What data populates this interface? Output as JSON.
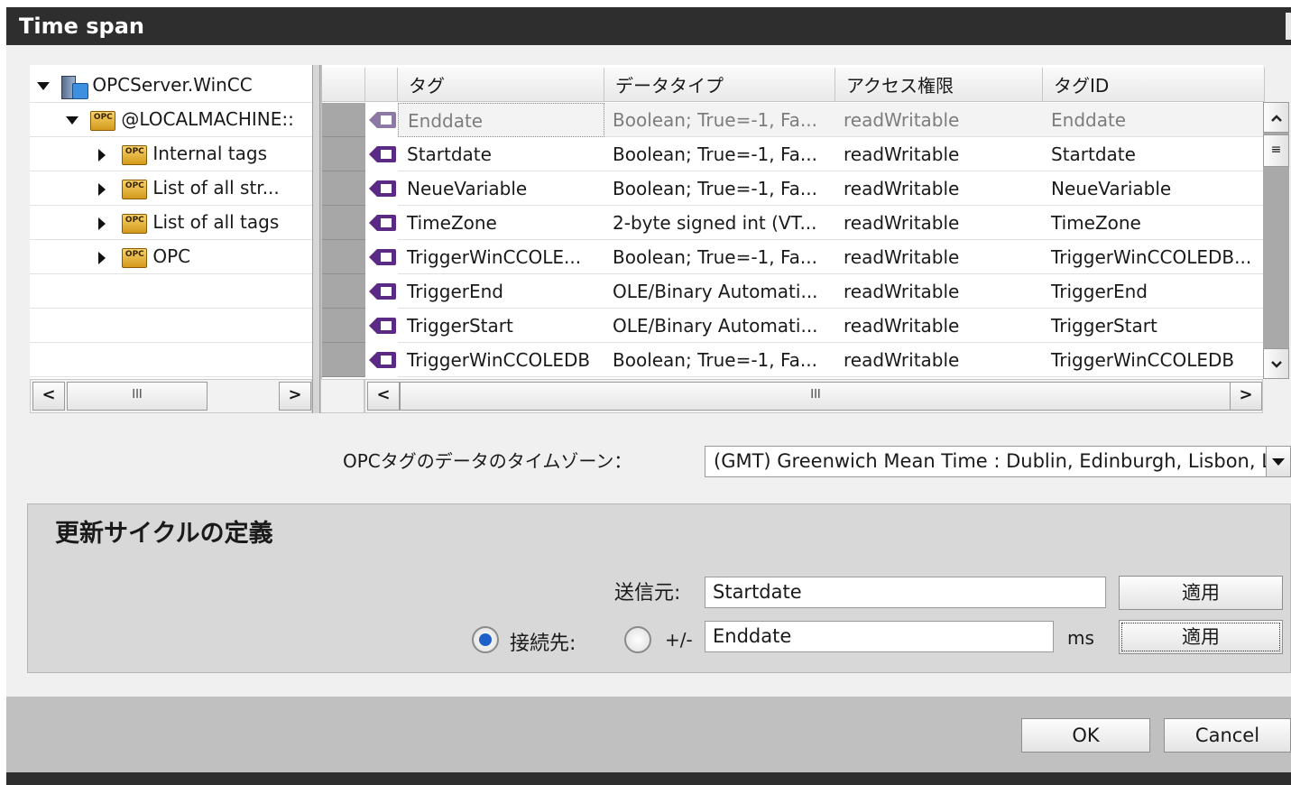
{
  "window": {
    "title": "Time span"
  },
  "tree": {
    "items": [
      {
        "label": "OPCServer.WinCC",
        "icon": "server-icon",
        "expanded": true
      },
      {
        "label": "@LOCALMACHINE::",
        "icon": "opc-folder-icon",
        "expanded": true
      },
      {
        "label": "Internal tags",
        "icon": "opc-folder-icon",
        "expanded": false
      },
      {
        "label": "List of all str...",
        "icon": "opc-folder-icon",
        "expanded": false
      },
      {
        "label": "List of all tags",
        "icon": "opc-folder-icon",
        "expanded": false
      },
      {
        "label": "OPC",
        "icon": "opc-folder-icon",
        "expanded": false
      }
    ],
    "opc_icon_text": "OPC"
  },
  "table": {
    "columns": [
      "タグ",
      "データタイプ",
      "アクセス権限",
      "タグID"
    ],
    "rows": [
      {
        "tag": "Enddate",
        "type": "Boolean; True=-1, Fa...",
        "access": "readWritable",
        "id": "Enddate",
        "selected": true
      },
      {
        "tag": "Startdate",
        "type": "Boolean; True=-1, Fa...",
        "access": "readWritable",
        "id": "Startdate"
      },
      {
        "tag": "NeueVariable",
        "type": "Boolean; True=-1, Fa...",
        "access": "readWritable",
        "id": "NeueVariable"
      },
      {
        "tag": "TimeZone",
        "type": "2-byte signed int (VT...",
        "access": "readWritable",
        "id": "TimeZone"
      },
      {
        "tag": "TriggerWinCCOLE...",
        "type": "Boolean; True=-1, Fa...",
        "access": "readWritable",
        "id": "TriggerWinCCOLEDB..."
      },
      {
        "tag": "TriggerEnd",
        "type": "OLE/Binary Automati...",
        "access": "readWritable",
        "id": "TriggerEnd"
      },
      {
        "tag": "TriggerStart",
        "type": "OLE/Binary Automati...",
        "access": "readWritable",
        "id": "TriggerStart"
      },
      {
        "tag": "TriggerWinCCOLEDB",
        "type": "Boolean; True=-1, Fa...",
        "access": "readWritable",
        "id": "TriggerWinCCOLEDB"
      }
    ]
  },
  "timezone": {
    "label": "OPCタグのデータのタイムゾーン：",
    "value": "(GMT) Greenwich Mean Time : Dublin, Edinburgh, Lisbon, London"
  },
  "update_cycle": {
    "title": "更新サイクルの定義",
    "source_label": "送信元:",
    "source_value": "Startdate",
    "apply1": "適用",
    "target_label": "接続先:",
    "plusminus_label": "+/-",
    "target_value": "Enddate",
    "unit": "ms",
    "apply2": "適用"
  },
  "footer": {
    "ok": "OK",
    "cancel": "Cancel"
  },
  "scroll": {
    "left": "<",
    "right": ">",
    "up": "^",
    "down": "v",
    "grip": "III"
  },
  "colors": {
    "titlebar": "#2e2e2e",
    "dialog_bg": "#f0f0f0",
    "section_bg": "#d8d8d8",
    "radio_selected": "#1e5fc9",
    "tag_icon": "#5a2a84"
  }
}
